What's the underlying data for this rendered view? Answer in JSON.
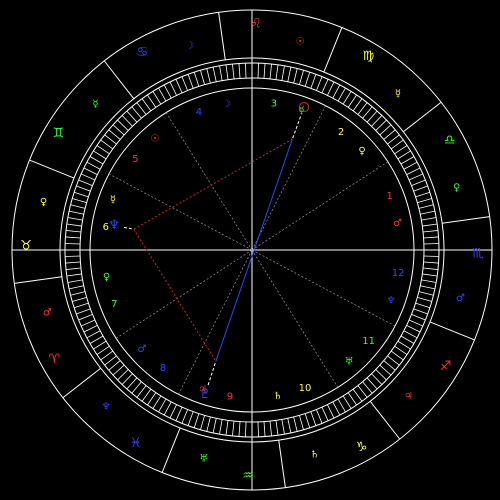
{
  "chart": {
    "background": "#000000",
    "line_color": "#ffffff",
    "sign_colors": {
      "fire": "#ff3333",
      "earth": "#ffff33",
      "air": "#33ff33",
      "water": "#3344ff"
    },
    "signs": [
      {
        "name": "aries",
        "symbol": "♈",
        "ruler": "♂",
        "color": "#ff3333"
      },
      {
        "name": "taurus",
        "symbol": "♉",
        "ruler": "♀",
        "color": "#ffff33"
      },
      {
        "name": "gemini",
        "symbol": "♊",
        "ruler": "☿",
        "color": "#33ff33"
      },
      {
        "name": "cancer",
        "symbol": "♋",
        "ruler": "☽",
        "color": "#3344ff"
      },
      {
        "name": "leo",
        "symbol": "♌",
        "ruler": "☉",
        "color": "#ff3333"
      },
      {
        "name": "virgo",
        "symbol": "♍",
        "ruler": "☿",
        "color": "#ffff33"
      },
      {
        "name": "libra",
        "symbol": "♎",
        "ruler": "♀",
        "color": "#33ff33"
      },
      {
        "name": "scorpio",
        "symbol": "♏",
        "ruler": "♂",
        "color": "#3344ff"
      },
      {
        "name": "sagittarius",
        "symbol": "♐",
        "ruler": "♃",
        "color": "#ff3333"
      },
      {
        "name": "capricorn",
        "symbol": "♑",
        "ruler": "♄",
        "color": "#ffff33"
      },
      {
        "name": "aquarius",
        "symbol": "♒",
        "ruler": "♅",
        "color": "#33ff33"
      },
      {
        "name": "pisces",
        "symbol": "♓",
        "ruler": "♆",
        "color": "#3344ff"
      }
    ],
    "houses": [
      {
        "number": "1",
        "ruler": "♂",
        "color": "#ff3333"
      },
      {
        "number": "2",
        "ruler": "♀",
        "color": "#ffff33"
      },
      {
        "number": "3",
        "ruler": "☿",
        "color": "#33ff33"
      },
      {
        "number": "4",
        "ruler": "☽",
        "color": "#3344ff"
      },
      {
        "number": "5",
        "ruler": "☉",
        "color": "#ff3333"
      },
      {
        "number": "6",
        "ruler": "☿",
        "color": "#ffff33"
      },
      {
        "number": "7",
        "ruler": "♀",
        "color": "#33ff33"
      },
      {
        "number": "8",
        "ruler": "♂",
        "color": "#3344ff"
      },
      {
        "number": "9",
        "ruler": "♃",
        "color": "#ff3333"
      },
      {
        "number": "10",
        "ruler": "♄",
        "color": "#ffff33"
      },
      {
        "number": "11",
        "ruler": "♅",
        "color": "#33ff33"
      },
      {
        "number": "12",
        "ruler": "♆",
        "color": "#3344ff"
      }
    ],
    "planets": [
      {
        "name": "sun",
        "symbol": "○",
        "color": "#ff3333"
      },
      {
        "name": "neptune",
        "symbol": "♆",
        "color": "#3344ff"
      },
      {
        "name": "pluto",
        "symbol": "♇",
        "color": "#3344ff"
      }
    ],
    "aspects": [
      {
        "name": "sun-pluto",
        "color": "#3344ff",
        "style": "solid"
      },
      {
        "name": "sun-neptune",
        "color": "#cc2222",
        "style": "dotted"
      },
      {
        "name": "neptune-pluto",
        "color": "#cc2222",
        "style": "dotted"
      }
    ]
  }
}
